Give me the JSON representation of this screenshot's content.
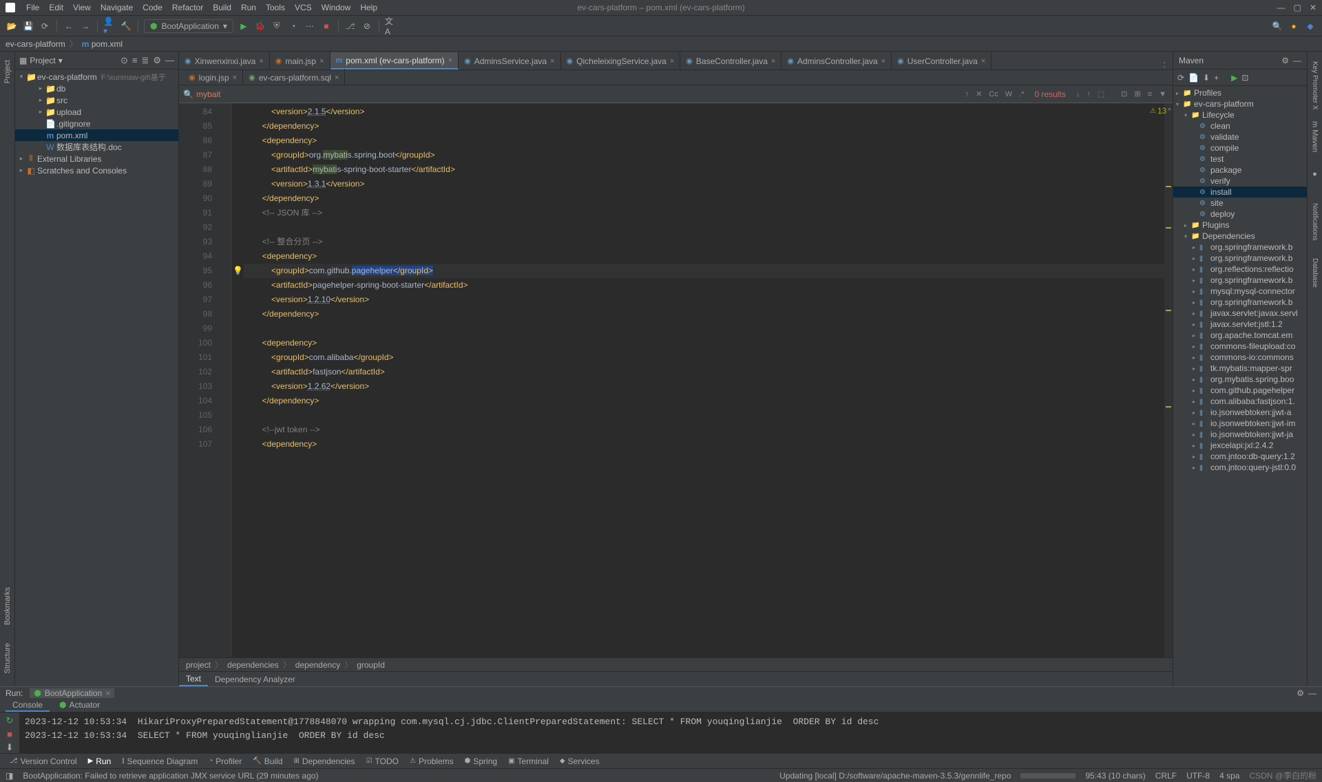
{
  "titlebar": {
    "title": "ev-cars-platform – pom.xml (ev-cars-platform)",
    "menus": [
      "File",
      "Edit",
      "View",
      "Navigate",
      "Code",
      "Refactor",
      "Build",
      "Run",
      "Tools",
      "VCS",
      "Window",
      "Help"
    ]
  },
  "navbar": {
    "root": "ev-cars-platform",
    "file": "pom.xml"
  },
  "runconfig": "BootApplication",
  "project": {
    "title": "Project",
    "root": {
      "name": "ev-cars-platform",
      "path": "F:\\xunmaw-git\\基于"
    },
    "children": [
      {
        "name": "db",
        "type": "folder",
        "depth": 2
      },
      {
        "name": "src",
        "type": "folder",
        "depth": 2
      },
      {
        "name": "upload",
        "type": "folder",
        "depth": 2
      },
      {
        "name": ".gitignore",
        "type": "file",
        "depth": 2
      },
      {
        "name": "pom.xml",
        "type": "pom",
        "depth": 2,
        "selected": true
      },
      {
        "name": "数据库表结构.doc",
        "type": "doc",
        "depth": 2
      }
    ],
    "extlib": "External Libraries",
    "scratches": "Scratches and Consoles"
  },
  "tabs_row1": [
    {
      "label": "Xinwenxinxi.java",
      "icon": "java"
    },
    {
      "label": "main.jsp",
      "icon": "jsp"
    },
    {
      "label": "pom.xml (ev-cars-platform)",
      "icon": "xml",
      "active": true
    },
    {
      "label": "AdminsService.java",
      "icon": "java"
    },
    {
      "label": "QicheleixingService.java",
      "icon": "java"
    },
    {
      "label": "BaseController.java",
      "icon": "java"
    },
    {
      "label": "AdminsController.java",
      "icon": "java"
    },
    {
      "label": "UserController.java",
      "icon": "java"
    }
  ],
  "tabs_row2": [
    {
      "label": "login.jsp",
      "icon": "jsp"
    },
    {
      "label": "ev-cars-platform.sql",
      "icon": "sql"
    }
  ],
  "find": {
    "query": "mybait",
    "results": "0 results",
    "warn_count": "13"
  },
  "code": {
    "first_line_no": 84,
    "lines": [
      {
        "html": "            <span class='tag'>&lt;version&gt;</span><span class='ver'>2.1.5</span><span class='tag'>&lt;/version&gt;</span>"
      },
      {
        "html": "        <span class='tag'>&lt;/dependency&gt;</span>"
      },
      {
        "html": "        <span class='tag'>&lt;dependency&gt;</span>"
      },
      {
        "html": "            <span class='tag'>&lt;groupId&gt;</span>org.<span class='find-hl'>mybati</span>s.spring.boot<span class='tag'>&lt;/groupId&gt;</span>"
      },
      {
        "html": "            <span class='tag'>&lt;artifactId&gt;</span><span class='find-hl'>mybati</span>s-spring-boot-starter<span class='tag'>&lt;/artifactId&gt;</span>"
      },
      {
        "html": "            <span class='tag'>&lt;version&gt;</span><span class='ver'>1.3.1</span><span class='tag'>&lt;/version&gt;</span>"
      },
      {
        "html": "        <span class='tag'>&lt;/dependency&gt;</span>"
      },
      {
        "html": "        <span class='comment'>&lt;!-- JSON 库 --&gt;</span>"
      },
      {
        "html": ""
      },
      {
        "html": "        <span class='comment'>&lt;!-- 整合分页 --&gt;</span>"
      },
      {
        "html": "        <span class='tag'>&lt;dependency&gt;</span>"
      },
      {
        "current": true,
        "html": "            <span class='tag'>&lt;groupId&gt;</span>com.github.<span class='sel'>pagehelper</span><span class='tag sel'>&lt;/groupId&gt;</span>"
      },
      {
        "html": "            <span class='tag'>&lt;artifactId&gt;</span>pagehelper-spring-boot-starter<span class='tag'>&lt;/artifactId&gt;</span>"
      },
      {
        "html": "            <span class='tag'>&lt;version&gt;</span><span class='ver'>1.2.10</span><span class='tag'>&lt;/version&gt;</span>"
      },
      {
        "html": "        <span class='tag'>&lt;/dependency&gt;</span>"
      },
      {
        "html": ""
      },
      {
        "html": "        <span class='tag'>&lt;dependency&gt;</span>"
      },
      {
        "html": "            <span class='tag'>&lt;groupId&gt;</span>com.alibaba<span class='tag'>&lt;/groupId&gt;</span>"
      },
      {
        "html": "            <span class='tag'>&lt;artifactId&gt;</span>fastjson<span class='tag'>&lt;/artifactId&gt;</span>"
      },
      {
        "html": "            <span class='tag'>&lt;version&gt;</span><span class='ver'>1.2.62</span><span class='tag'>&lt;/version&gt;</span>"
      },
      {
        "html": "        <span class='tag'>&lt;/dependency&gt;</span>"
      },
      {
        "html": ""
      },
      {
        "html": "        <span class='comment'>&lt;!--jwt token --&gt;</span>"
      },
      {
        "html": "        <span class='tag'>&lt;dependency&gt;</span>"
      }
    ]
  },
  "breadcrumb": [
    "project",
    "dependencies",
    "dependency",
    "groupId"
  ],
  "editor_bottom_tabs": [
    "Text",
    "Dependency Analyzer"
  ],
  "maven": {
    "title": "Maven",
    "profiles": "Profiles",
    "project": "ev-cars-platform",
    "lifecycle_label": "Lifecycle",
    "lifecycle": [
      "clean",
      "validate",
      "compile",
      "test",
      "package",
      "verify",
      "install",
      "site",
      "deploy"
    ],
    "lifecycle_selected": "install",
    "plugins": "Plugins",
    "dependencies_label": "Dependencies",
    "deps": [
      "org.springframework.b",
      "org.springframework.b",
      "org.reflections:reflectio",
      "org.springframework.b",
      "mysql:mysql-connector",
      "org.springframework.b",
      "javax.servlet:javax.servl",
      "javax.servlet:jstl:1.2",
      "org.apache.tomcat.em",
      "commons-fileupload:co",
      "commons-io:commons",
      "tk.mybatis:mapper-spr",
      "org.mybatis.spring.boo",
      "com.github.pagehelper",
      "com.alibaba:fastjson:1.",
      "io.jsonwebtoken:jjwt-a",
      "io.jsonwebtoken:jjwt-im",
      "io.jsonwebtoken:jjwt-ja",
      "jexcelapi:jxl:2.4.2",
      "com.jntoo:db-query:1.2",
      "com.jntoo:query-jstl:0.0"
    ]
  },
  "run": {
    "label": "Run:",
    "tab": "BootApplication",
    "sub_tabs": [
      "Console",
      "Actuator"
    ],
    "lines": [
      "2023-12-12 10:53:34  HikariProxyPreparedStatement@1778848070 wrapping com.mysql.cj.jdbc.ClientPreparedStatement: SELECT * FROM youqinglianjie  ORDER BY id desc",
      "2023-12-12 10:53:34  SELECT * FROM youqinglianjie  ORDER BY id desc"
    ]
  },
  "bottom_tabs": [
    "Version Control",
    "Run",
    "Sequence Diagram",
    "Profiler",
    "Build",
    "Dependencies",
    "TODO",
    "Problems",
    "Spring",
    "Terminal",
    "Services"
  ],
  "status": {
    "message": "BootApplication: Failed to retrieve application JMX service URL (29 minutes ago)",
    "updating": "Updating [local] D:/software/apache-maven-3.5.3/gennlife_repo",
    "pos": "95:43 (10 chars)",
    "eol": "CRLF",
    "enc": "UTF-8",
    "indent": "4 spa",
    "watermark": "CSDN @李白的粉"
  }
}
